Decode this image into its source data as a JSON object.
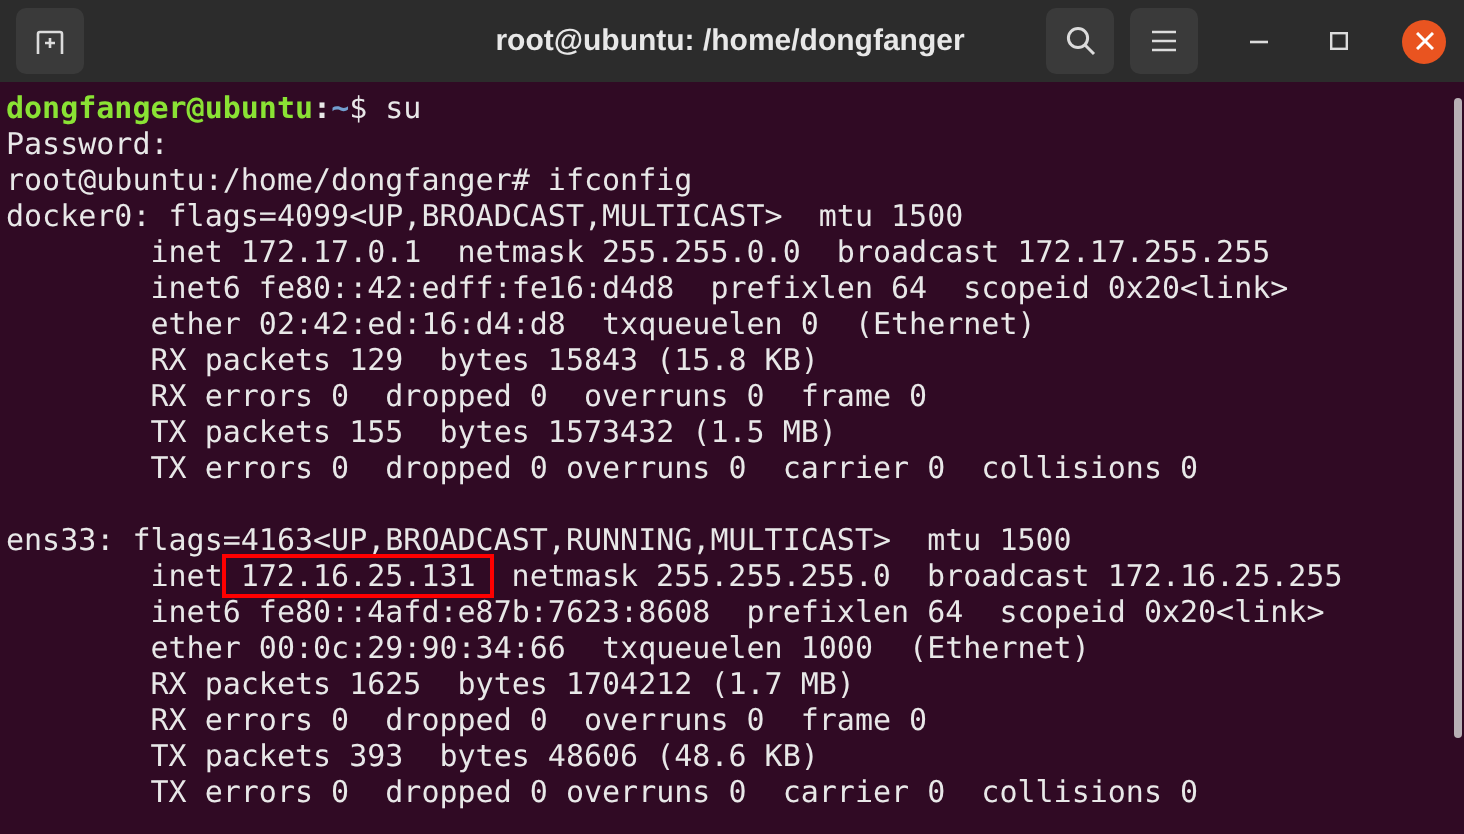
{
  "window": {
    "title": "root@ubuntu: /home/dongfanger"
  },
  "terminal": {
    "lines": [
      {
        "kind": "user_prompt",
        "user_host": "dongfanger@ubuntu",
        "separator": ":",
        "path": "~",
        "symbol": "$",
        "command": "su"
      },
      {
        "kind": "output",
        "text": "Password:"
      },
      {
        "kind": "output",
        "text": "root@ubuntu:/home/dongfanger# ifconfig"
      },
      {
        "kind": "output",
        "text": "docker0: flags=4099<UP,BROADCAST,MULTICAST>  mtu 1500"
      },
      {
        "kind": "output",
        "text": "        inet 172.17.0.1  netmask 255.255.0.0  broadcast 172.17.255.255"
      },
      {
        "kind": "output",
        "text": "        inet6 fe80::42:edff:fe16:d4d8  prefixlen 64  scopeid 0x20<link>"
      },
      {
        "kind": "output",
        "text": "        ether 02:42:ed:16:d4:d8  txqueuelen 0  (Ethernet)"
      },
      {
        "kind": "output",
        "text": "        RX packets 129  bytes 15843 (15.8 KB)"
      },
      {
        "kind": "output",
        "text": "        RX errors 0  dropped 0  overruns 0  frame 0"
      },
      {
        "kind": "output",
        "text": "        TX packets 155  bytes 1573432 (1.5 MB)"
      },
      {
        "kind": "output",
        "text": "        TX errors 0  dropped 0 overruns 0  carrier 0  collisions 0"
      },
      {
        "kind": "blank"
      },
      {
        "kind": "output",
        "text": "ens33: flags=4163<UP,BROADCAST,RUNNING,MULTICAST>  mtu 1500"
      },
      {
        "kind": "marked",
        "before": "        inet",
        "marked": "172.16.25.131",
        "after": " netmask 255.255.255.0  broadcast 172.16.25.255"
      },
      {
        "kind": "output",
        "text": "        inet6 fe80::4afd:e87b:7623:8608  prefixlen 64  scopeid 0x20<link>"
      },
      {
        "kind": "output",
        "text": "        ether 00:0c:29:90:34:66  txqueuelen 1000  (Ethernet)"
      },
      {
        "kind": "output",
        "text": "        RX packets 1625  bytes 1704212 (1.7 MB)"
      },
      {
        "kind": "output",
        "text": "        RX errors 0  dropped 0  overruns 0  frame 0"
      },
      {
        "kind": "output",
        "text": "        TX packets 393  bytes 48606 (48.6 KB)"
      },
      {
        "kind": "output",
        "text": "        TX errors 0  dropped 0 overruns 0  carrier 0  collisions 0"
      }
    ]
  }
}
